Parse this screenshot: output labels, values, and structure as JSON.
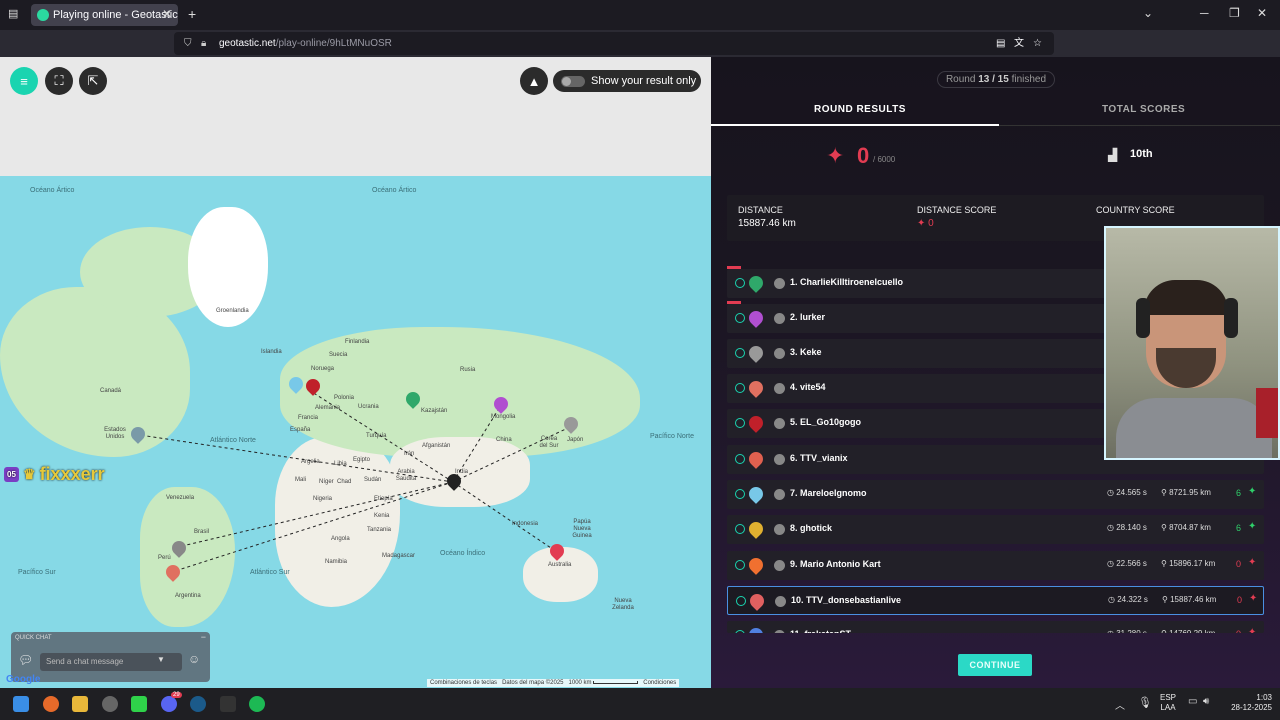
{
  "browser": {
    "tab_title": "Playing online - Geotastic",
    "url_host": "geotastic.net",
    "url_path": "/play-online/9hLtMNuOSR"
  },
  "map": {
    "toggle_label": "Show your result only",
    "oceans": [
      "Océano Ártico",
      "Océano Ártico",
      "Atlántico Norte",
      "Pacífico Norte",
      "Pacífico Sur",
      "Atlántico Sur",
      "Océano Índico"
    ],
    "labels": [
      "Groenlandia",
      "Islandia",
      "Canadá",
      "Estados Unidos",
      "Venezuela",
      "Brasil",
      "Perú",
      "Argentina",
      "Noruega",
      "Finlandia",
      "Suecia",
      "Alemania",
      "Polonia",
      "Ucrania",
      "España",
      "Francia",
      "Rusia",
      "Kazajstán",
      "Mongolia",
      "China",
      "Corea del Sur",
      "Japón",
      "Turquía",
      "Irán",
      "Afganistán",
      "Argelia",
      "Libia",
      "Egipto",
      "Mali",
      "Níger",
      "Chad",
      "Sudán",
      "Nigeria",
      "Etiopía",
      "Kenia",
      "Tanzania",
      "Angola",
      "Namibia",
      "Madagascar",
      "India",
      "Indonesia",
      "Papúa Nueva Guinea",
      "Australia",
      "Nueva Zelanda",
      "Arabia Saudita"
    ],
    "player_name": "fixxxerr",
    "player_level": "05",
    "quick_chat_title": "QUICK CHAT",
    "chat_placeholder": "Send a chat message",
    "footer": {
      "shortcuts": "Combinaciones de teclas",
      "data": "Datos del mapa ©2025",
      "scale": "1000 km",
      "terms": "Condiciones"
    },
    "google": "Google"
  },
  "panel": {
    "round_prefix": "Round",
    "round": "13 / 15",
    "round_suffix": "finished",
    "tabs": [
      "ROUND RESULTS",
      "TOTAL SCORES"
    ],
    "score": "0",
    "score_max": "/ 6000",
    "rank": "10th",
    "stats": {
      "distance_label": "DISTANCE",
      "distance_value": "15887.46 km",
      "distance_score_label": "DISTANCE SCORE",
      "distance_score_value": "0",
      "country_score_label": "COUNTRY SCORE"
    },
    "rows": [
      {
        "name": "1. CharlieKilltiroenelcuello",
        "time": "",
        "dist": "",
        "pts": "",
        "color": "#2fa86a"
      },
      {
        "name": "2. lurker",
        "time": "",
        "dist": "",
        "pts": "",
        "color": "#b04fd0"
      },
      {
        "name": "3. Keke",
        "time": "",
        "dist": "",
        "pts": "",
        "color": "#999999"
      },
      {
        "name": "4. vite54",
        "time": "",
        "dist": "",
        "pts": "",
        "color": "#e07060"
      },
      {
        "name": "5. EL_Go10gogo",
        "time": "",
        "dist": "",
        "pts": "",
        "color": "#c0202a"
      },
      {
        "name": "6. TTV_vianix",
        "time": "",
        "dist": "",
        "pts": "",
        "color": "#e0604f"
      },
      {
        "name": "7. Mareloelgnomo",
        "time": "24.565 s",
        "dist": "8721.95 km",
        "pts": "6",
        "color": "#78c8e8"
      },
      {
        "name": "8. ghotick",
        "time": "28.140 s",
        "dist": "8704.87 km",
        "pts": "6",
        "color": "#e0b030"
      },
      {
        "name": "9. Mario Antonio Kart",
        "time": "22.566 s",
        "dist": "15896.17 km",
        "pts": "0",
        "color": "#f07030"
      },
      {
        "name": "10. TTV_donsebastianlive",
        "time": "24.322 s",
        "dist": "15887.46 km",
        "pts": "0",
        "color": "#e06060"
      },
      {
        "name": "11. frakatanST",
        "time": "31.280 s",
        "dist": "14769.29 km",
        "pts": "0",
        "color": "#5080e0"
      }
    ],
    "continue_label": "CONTINUE"
  },
  "taskbar": {
    "lang": "ESP",
    "lang2": "LAA",
    "time": "1:03",
    "date": "28-12-2025",
    "steam_badge": "29"
  },
  "colors": {
    "accent": "#1ad4b0",
    "red": "#e23c52",
    "highlight": "#4a90e2"
  }
}
